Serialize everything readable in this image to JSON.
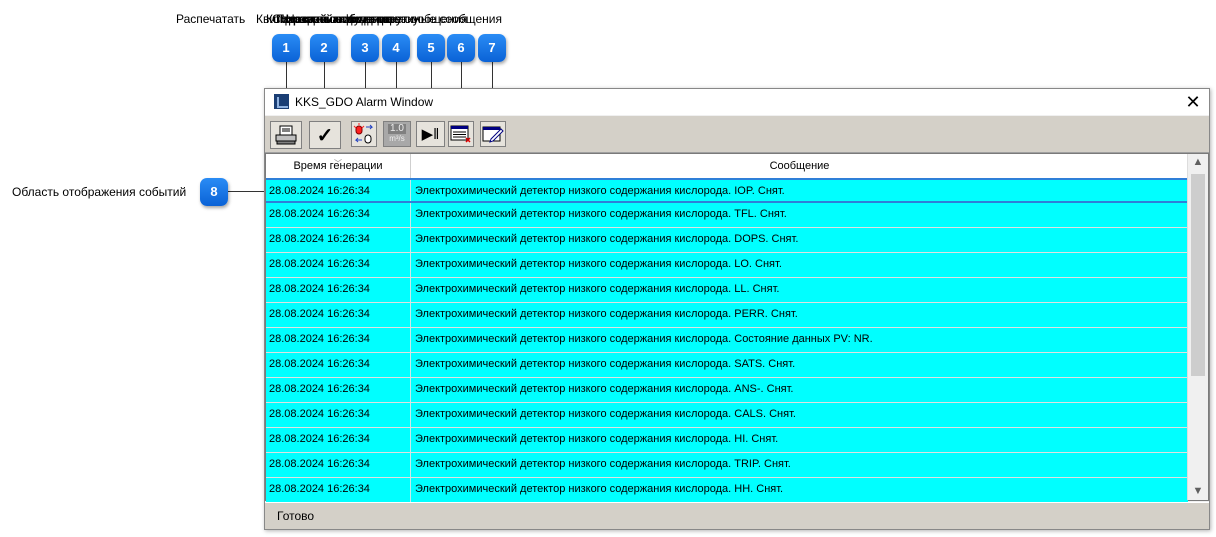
{
  "annotations": {
    "overlapping_labels": [
      "Распечатать",
      "Квитировать сообщение",
      "Копировать полученные сообщения",
      "Сохранить отфильтрованные сообщения",
      "Приостановить прокрутку",
      "Настройка фильтра",
      "Настройка вида окна"
    ],
    "badges": [
      "1",
      "2",
      "3",
      "4",
      "5",
      "6",
      "7",
      "8"
    ],
    "event_area_label": "Область отображения событий"
  },
  "window": {
    "title": "KKS_GDO Alarm Window",
    "close_symbol": "✕",
    "toolbar": {
      "buttons": [
        {
          "icon": "print-icon"
        },
        {
          "icon": "check-icon",
          "glyph": "✓"
        },
        {
          "icon": "alarm-copy-icon"
        },
        {
          "icon": "units-icon",
          "line1": "1.0",
          "line2": "m³/s"
        },
        {
          "icon": "play-pause-icon",
          "glyph": "▶‖"
        },
        {
          "icon": "filter-list-icon"
        },
        {
          "icon": "edit-view-icon"
        }
      ]
    },
    "table": {
      "columns": [
        "Время генерации",
        "Сообщение"
      ],
      "rows": [
        {
          "time": "28.08.2024 16:26:34",
          "message": "Электрохимический детектор низкого содержания кислорода. IOP. Снят."
        },
        {
          "time": "28.08.2024 16:26:34",
          "message": "Электрохимический детектор низкого содержания кислорода. TFL. Снят."
        },
        {
          "time": "28.08.2024 16:26:34",
          "message": "Электрохимический детектор низкого содержания кислорода. DOPS. Снят."
        },
        {
          "time": "28.08.2024 16:26:34",
          "message": "Электрохимический детектор низкого содержания кислорода. LO. Снят."
        },
        {
          "time": "28.08.2024 16:26:34",
          "message": "Электрохимический детектор низкого содержания кислорода. LL. Снят."
        },
        {
          "time": "28.08.2024 16:26:34",
          "message": "Электрохимический детектор низкого содержания кислорода. PERR. Снят."
        },
        {
          "time": "28.08.2024 16:26:34",
          "message": "Электрохимический детектор низкого содержания кислорода. Состояние данных PV: NR."
        },
        {
          "time": "28.08.2024 16:26:34",
          "message": "Электрохимический детектор низкого содержания кислорода. SATS. Снят."
        },
        {
          "time": "28.08.2024 16:26:34",
          "message": "Электрохимический детектор низкого содержания кислорода. ANS-. Снят."
        },
        {
          "time": "28.08.2024 16:26:34",
          "message": "Электрохимический детектор низкого содержания кислорода. CALS. Снят."
        },
        {
          "time": "28.08.2024 16:26:34",
          "message": "Электрохимический детектор низкого содержания кислорода. HI. Снят."
        },
        {
          "time": "28.08.2024 16:26:34",
          "message": "Электрохимический детектор низкого содержания кислорода. TRIP. Снят."
        },
        {
          "time": "28.08.2024 16:26:34",
          "message": "Электрохимический детектор низкого содержания кислорода. HH. Снят."
        }
      ],
      "row_color": "#00ffff",
      "selected_border_color": "#2f7fd8"
    },
    "status": "Готово"
  },
  "colors": {
    "badge": "#1574e8",
    "toolbar": "#d4d0c8"
  }
}
